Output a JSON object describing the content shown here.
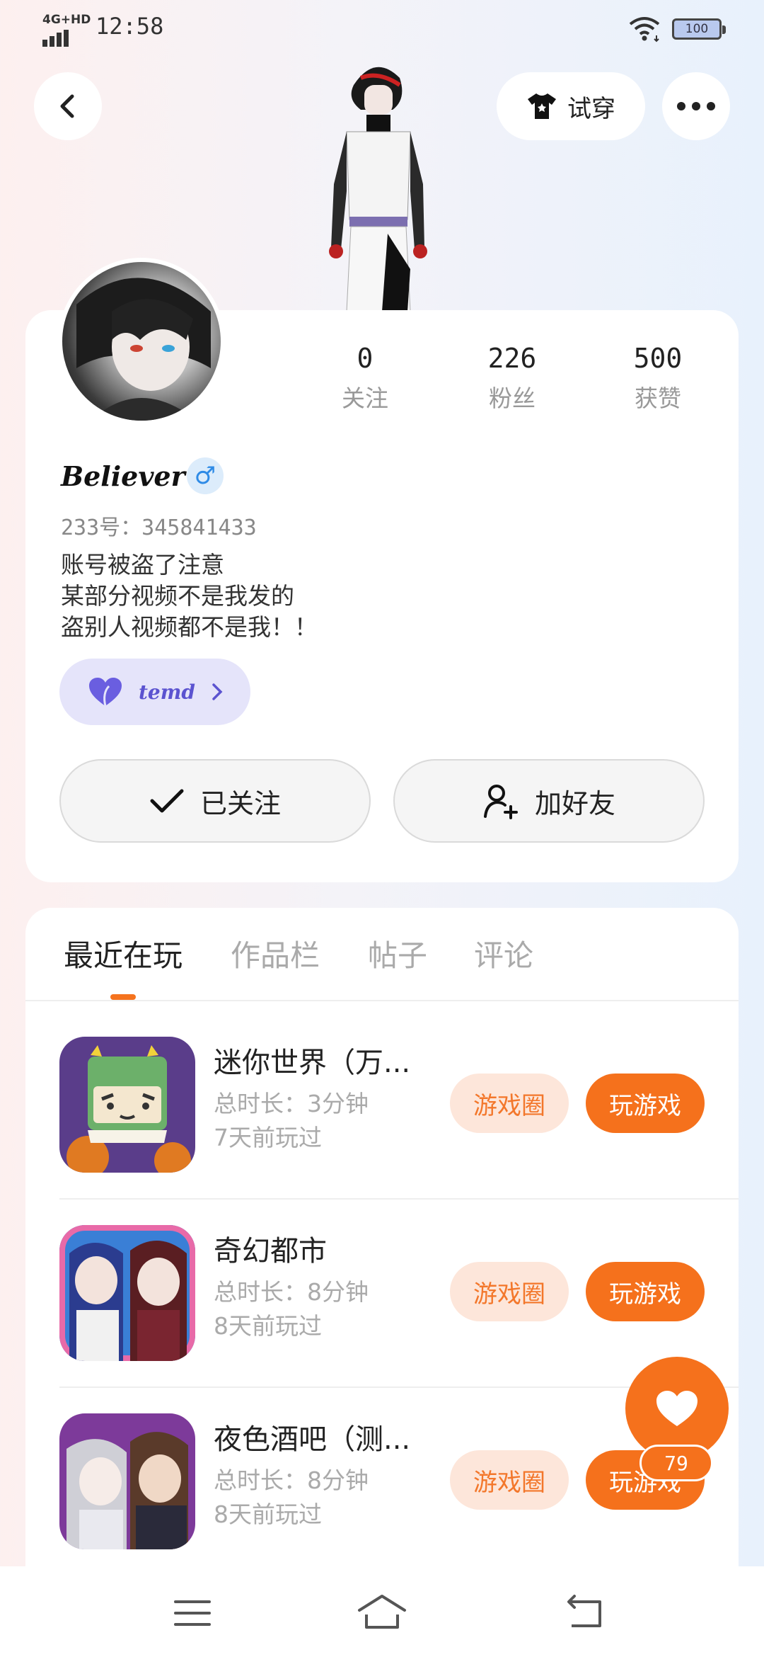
{
  "status_bar": {
    "network": "4G+HD",
    "time": "12:58",
    "battery": "100"
  },
  "top_bar": {
    "tryon_label": "试穿"
  },
  "profile": {
    "stats": [
      {
        "value": "0",
        "label": "关注"
      },
      {
        "value": "226",
        "label": "粉丝"
      },
      {
        "value": "500",
        "label": "获赞"
      }
    ],
    "username": "Believer",
    "gender_symbol": "♂",
    "account_id": "233号：345841433",
    "bio": [
      "账号被盗了注意",
      "某部分视频不是我发的",
      "盗别人视频都不是我！！"
    ],
    "tag_label": "temd",
    "followed_label": "已关注",
    "add_friend_label": "加好友"
  },
  "tabs": [
    "最近在玩",
    "作品栏",
    "帖子",
    "评论"
  ],
  "games": [
    {
      "title": "迷你世界（万...",
      "duration": "总时长：3分钟",
      "last_played": "7天前玩过",
      "circle_label": "游戏圈",
      "play_label": "玩游戏"
    },
    {
      "title": "奇幻都市",
      "duration": "总时长：8分钟",
      "last_played": "8天前玩过",
      "circle_label": "游戏圈",
      "play_label": "玩游戏"
    },
    {
      "title": "夜色酒吧（测...",
      "duration": "总时长：8分钟",
      "last_played": "8天前玩过",
      "circle_label": "游戏圈",
      "play_label": "玩游戏"
    }
  ],
  "like_count": "79",
  "colors": {
    "accent": "#f5711c",
    "accent_light": "#fde6da",
    "tag_bg": "#e5e4fa",
    "gender": "#2f8be6"
  },
  "icons": {
    "back": "chevron-left-icon",
    "tryon": "tshirt-icon",
    "more": "more-dots-icon",
    "gender": "male-icon",
    "tag": "heart-icon",
    "followed": "check-icon",
    "add_friend": "user-plus-icon",
    "like": "heart-icon",
    "nav": [
      "menu-icon",
      "home-icon",
      "back-icon"
    ]
  }
}
